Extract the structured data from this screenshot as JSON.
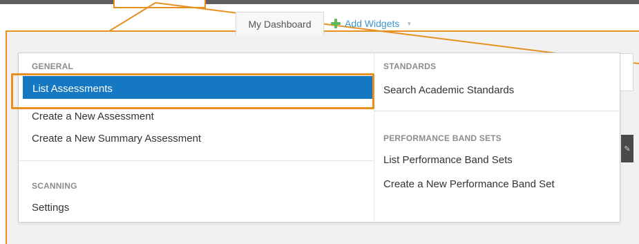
{
  "tabs": {
    "dashboard": "My Dashboard",
    "add_widgets": "Add Widgets"
  },
  "menu": {
    "general": {
      "header": "GENERAL",
      "items": [
        "List Assessments",
        "Create a New Assessment",
        "Create a New Summary Assessment"
      ]
    },
    "scanning": {
      "header": "SCANNING",
      "items": [
        "Settings"
      ]
    },
    "standards": {
      "header": "STANDARDS",
      "items": [
        "Search Academic Standards"
      ]
    },
    "performance_band_sets": {
      "header": "PERFORMANCE BAND SETS",
      "items": [
        "List Performance Band Sets",
        "Create a New Performance Band Set"
      ]
    }
  },
  "active_item": "List Assessments",
  "icons": {
    "add": "plus-icon",
    "caret": "caret-down-icon",
    "edit": "pencil-icon"
  },
  "colors": {
    "accent_highlight": "#e8901f",
    "active_item_bg": "#1479c2",
    "link": "#3b95d0",
    "plus": "#5bb85d"
  }
}
